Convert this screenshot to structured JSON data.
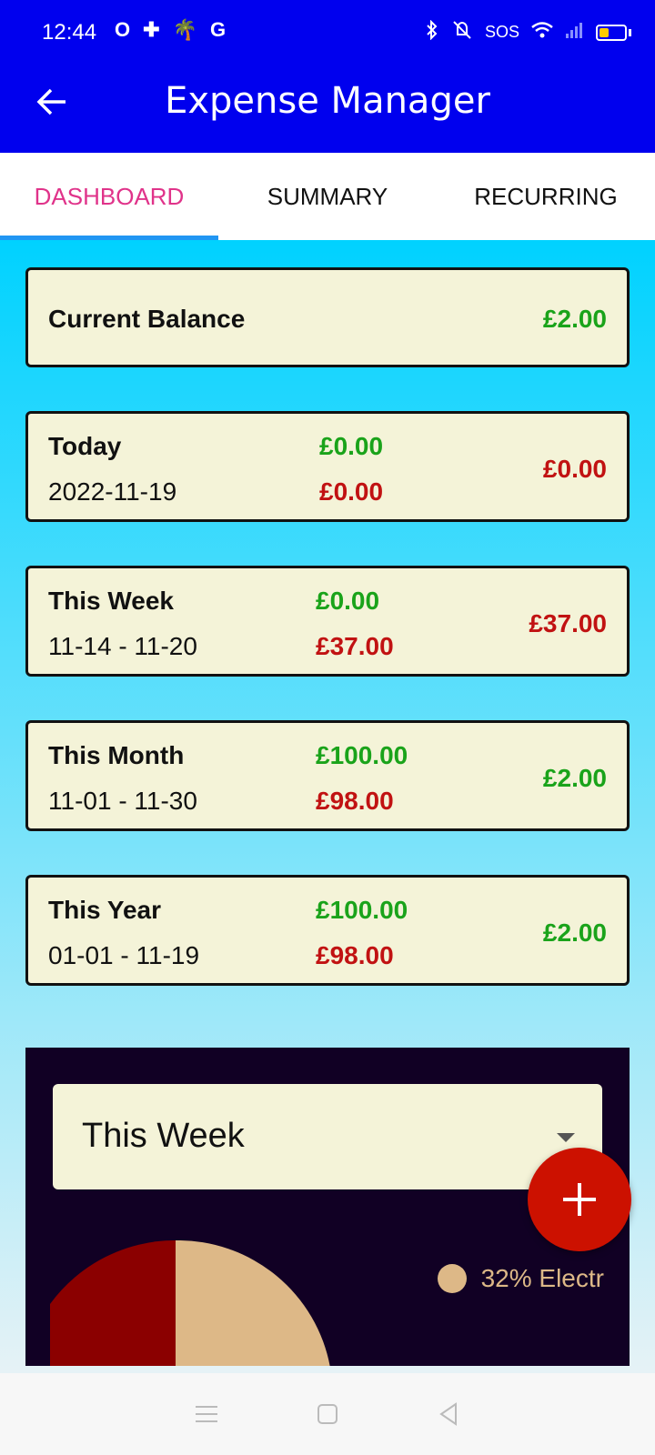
{
  "status": {
    "time": "12:44",
    "left_icons": [
      "O",
      "✚",
      "🌴",
      "G"
    ],
    "sos": "SOS"
  },
  "header": {
    "title": "Expense Manager"
  },
  "tabs": [
    {
      "label": "DASHBOARD",
      "active": true
    },
    {
      "label": "SUMMARY",
      "active": false
    },
    {
      "label": "RECURRING",
      "active": false
    }
  ],
  "balance": {
    "label": "Current Balance",
    "amount": "£2.00"
  },
  "periods": [
    {
      "label": "Today",
      "range": "2022-11-19",
      "income": "£0.00",
      "expense": "£0.00",
      "net": "£0.00",
      "net_color": "red"
    },
    {
      "label": "This Week",
      "range": "11-14 - 11-20",
      "income": "£0.00",
      "expense": "£37.00",
      "net": "£37.00",
      "net_color": "red"
    },
    {
      "label": "This Month",
      "range": "11-01 - 11-30",
      "income": "£100.00",
      "expense": "£98.00",
      "net": "£2.00",
      "net_color": "green"
    },
    {
      "label": "This Year",
      "range": "01-01 - 11-19",
      "income": "£100.00",
      "expense": "£98.00",
      "net": "£2.00",
      "net_color": "green"
    }
  ],
  "chart_panel": {
    "selected_period": "This Week",
    "legend": [
      {
        "text": "32% Electr",
        "color": "#ddb887"
      }
    ],
    "slice_colors": [
      "#8b0000",
      "#ddb887"
    ]
  },
  "fab": {
    "icon": "plus-icon"
  },
  "colors": {
    "appbar": "#0000ee",
    "accent_tab": "#e0338a",
    "income": "#1aa31a",
    "expense": "#c11212",
    "card_bg": "#f4f3d8"
  }
}
